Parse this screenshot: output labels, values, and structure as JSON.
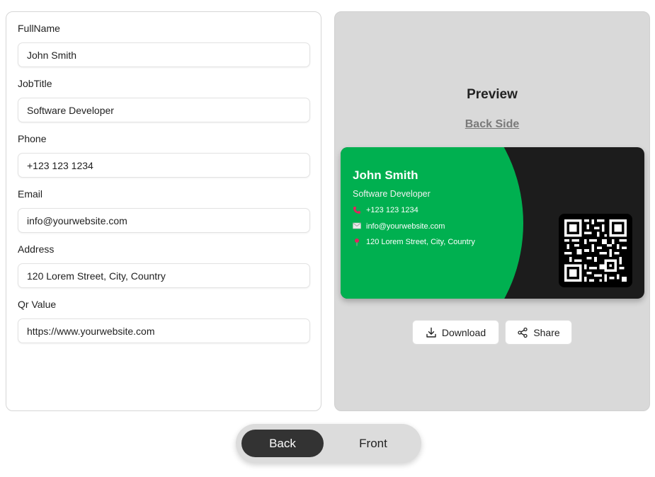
{
  "form": {
    "fields": [
      {
        "label": "FullName",
        "value": "John Smith"
      },
      {
        "label": "JobTitle",
        "value": "Software Developer"
      },
      {
        "label": "Phone",
        "value": "+123 123 1234"
      },
      {
        "label": "Email",
        "value": "info@yourwebsite.com"
      },
      {
        "label": "Address",
        "value": "120 Lorem Street, City, Country"
      },
      {
        "label": "Qr Value",
        "value": "https://www.yourwebsite.com"
      }
    ]
  },
  "preview": {
    "title": "Preview",
    "back_side_link": "Back Side",
    "card": {
      "name": "John Smith",
      "job_title": "Software Developer",
      "phone": "+123 123 1234",
      "email": "info@yourwebsite.com",
      "address": "120 Lorem Street, City, Country",
      "colors": {
        "accent": "#00b050",
        "background": "#1c1c1c",
        "phone_icon": "#e0245e",
        "pin_icon": "#e0245e"
      },
      "icons": [
        "phone-icon",
        "mail-icon",
        "location-pin-icon",
        "qr-code"
      ]
    },
    "download_label": "Download",
    "share_label": "Share"
  },
  "toggle": {
    "back_label": "Back",
    "front_label": "Front",
    "active": "Back"
  }
}
